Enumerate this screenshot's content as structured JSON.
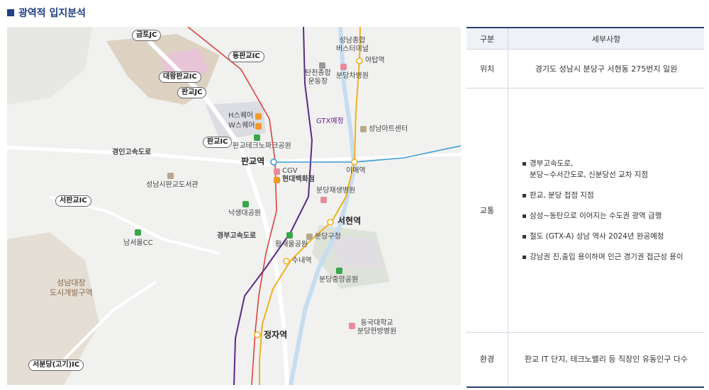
{
  "header": {
    "title": "광역적 입지분석"
  },
  "map": {
    "areas": [
      "성남대장\n도시개발구역"
    ],
    "ic_labels": [
      "금토JC",
      "동판교IC",
      "대왕판교IC",
      "판교JC",
      "판교IC",
      "서판교IC",
      "서분당(고기)IC"
    ],
    "stations": {
      "pangyo": "판교역",
      "imae": "이매역",
      "seohyeon": "서현역",
      "sunae": "수내역",
      "jeongja": "정자역",
      "yatap": "야탑역"
    },
    "gtx_label": "GTX예정",
    "roads": {
      "gyeongin": "경인고속도로",
      "gyeongbu": "경부고속도로"
    },
    "places": {
      "terminal": "성남종합\n버스터미널",
      "tancheon": "탄천종합\n운동장",
      "bundang_cha": "분당차병원",
      "art_center": "성남아트센터",
      "hsquare": "H스퀘어",
      "wsquare": "W스퀘어",
      "techno_park": "판교테크노파크공원",
      "cgv": "CGV",
      "hyundai": "현대백화점",
      "library": "성남시판교도서관",
      "rehab": "분당재생병원",
      "naksaengdae": "낙생대공원",
      "namseoul_cc": "남서울CC",
      "hwangsaeul": "황새울공원",
      "bundang_office": "분당구청",
      "central_park": "분당중앙공원",
      "dongguk": "동국대학교\n분당한방병원"
    }
  },
  "table": {
    "headers": [
      "구분",
      "세부사항"
    ],
    "rows": [
      {
        "label": "위치",
        "detail": "경기도 성남시 분당구 서현동 275번지 일원"
      },
      {
        "label": "교통",
        "items": [
          "경부고속도로,\n분당~수서간도로, 신분당선 교차 지점",
          "판교, 분당 접점 지점",
          "삼성~동탄으로 이어지는 수도권 광역 급행",
          "철도 (GTX-A) 성남 역사 2024년 완공예정",
          "강남권 진,출입 용이하며 인근 경기권 접근성 용이"
        ]
      },
      {
        "label": "환경",
        "detail": "판교 IT 단지, 테크노밸리 등 직장인 유동인구 다수"
      }
    ]
  }
}
